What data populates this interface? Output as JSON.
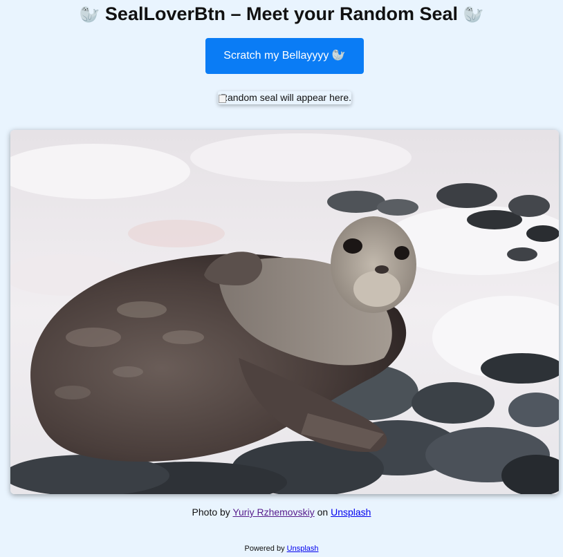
{
  "header": {
    "seal_emoji": "🦭",
    "title": "SealLoverBtn – Meet your Random Seal"
  },
  "button": {
    "label": "Scratch my Bellayyyy 🦭",
    "color": "#0a7cf5"
  },
  "broken_image": {
    "alt": "Random seal will appear here.",
    "icon": "broken-image-icon"
  },
  "photo": {
    "alt": "Weddell seal lying on snow and dark pebbles"
  },
  "credit": {
    "prefix": "Photo by ",
    "author": "Yuriy Rzhemovskiy",
    "middle": " on ",
    "site": "Unsplash"
  },
  "footer": {
    "prefix": "Powered by ",
    "link": "Unsplash"
  },
  "colors": {
    "background": "#e9f4fe",
    "link_visited": "#551a8b",
    "link": "#0000ee"
  }
}
